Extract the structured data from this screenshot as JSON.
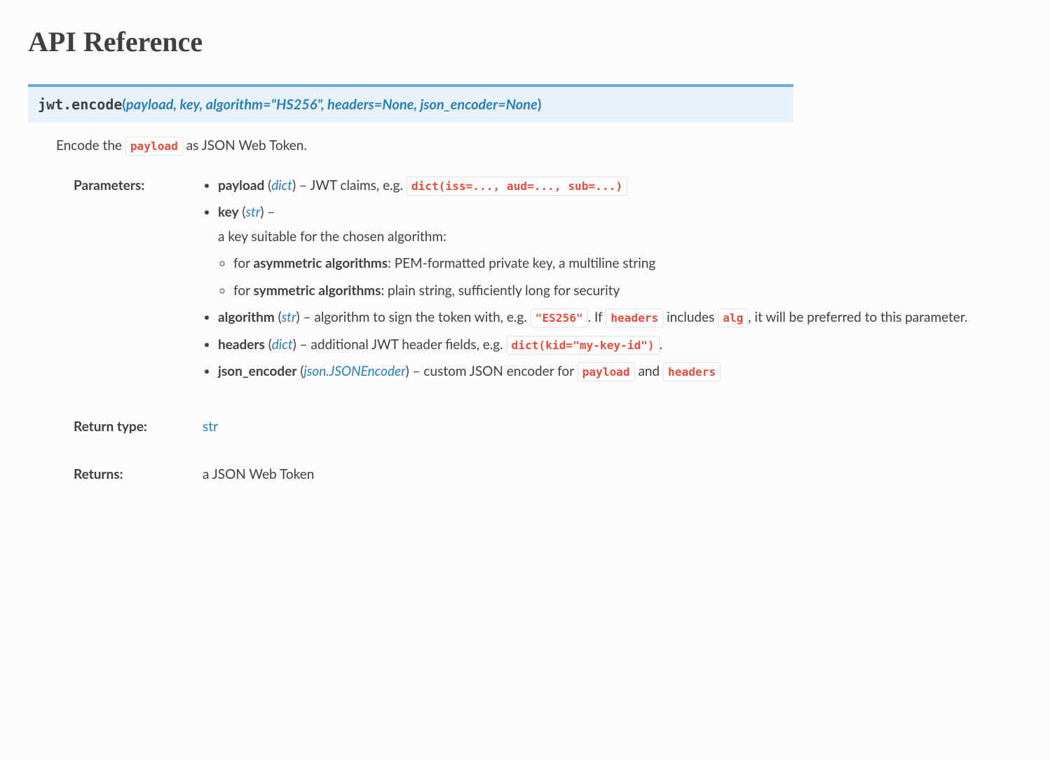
{
  "page": {
    "title": "API Reference"
  },
  "function": {
    "module": "jwt.",
    "name": "encode",
    "open_paren": "(",
    "close_paren": ")",
    "params_sig": "payload, key, algorithm=\"HS256\", headers=None, json_encoder=None",
    "desc_pre": "Encode the ",
    "desc_code": "payload",
    "desc_post": " as JSON Web Token."
  },
  "labels": {
    "parameters": "Parameters:",
    "return_type": "Return type:",
    "returns": "Returns:"
  },
  "params": {
    "payload": {
      "name": "payload",
      "type": "dict",
      "desc_pre": " – JWT claims, e.g. ",
      "code": "dict(iss=..., aud=..., sub=...)"
    },
    "key": {
      "name": "key",
      "type": "str",
      "dash": " –",
      "intro": "a key suitable for the chosen algorithm:",
      "sub_asym_pre": "for ",
      "sub_asym_label": "asymmetric algorithms",
      "sub_asym_post": ": PEM-formatted private key, a multiline string",
      "sub_sym_pre": "for ",
      "sub_sym_label": "symmetric algorithms",
      "sub_sym_post": ": plain string, sufficiently long for security"
    },
    "algorithm": {
      "name": "algorithm",
      "type": "str",
      "desc_pre": " – algorithm to sign the token with, e.g. ",
      "code1": "\"ES256\"",
      "mid1": ". If ",
      "code2": "headers",
      "mid2": " includes ",
      "code3": "alg",
      "post": ", it will be preferred to this parameter."
    },
    "headers": {
      "name": "headers",
      "type": "dict",
      "desc_pre": " – additional JWT header fields, e.g. ",
      "code": "dict(kid=\"my-key-id\")",
      "post": "."
    },
    "json_encoder": {
      "name": "json_encoder",
      "type": "json.JSONEncoder",
      "desc_pre": " – custom JSON encoder for ",
      "code1": "payload",
      "mid": " and ",
      "code2": "headers"
    }
  },
  "return_type": "str",
  "returns": "a JSON Web Token"
}
